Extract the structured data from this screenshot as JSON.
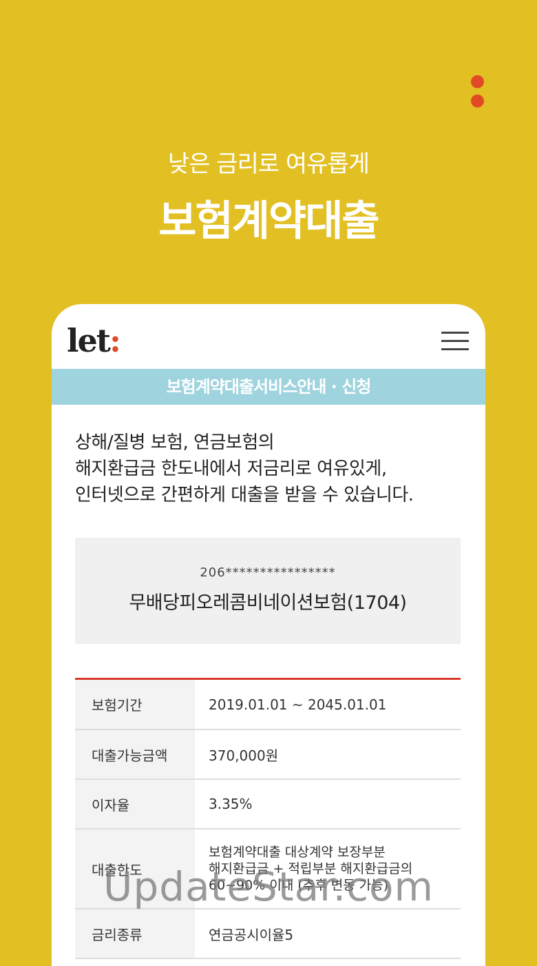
{
  "hero": {
    "subtitle": "낮은 금리로 여유롭게",
    "title": "보험계약대출"
  },
  "app": {
    "logo_text": "let",
    "logo_colon": ":",
    "service_bar": "보험계약대출서비스안내 · 신청"
  },
  "description": {
    "lines": [
      "상해/질병 보험, 연금보험의",
      "해지환급금 한도내에서 저금리로 여유있게,",
      "인터넷으로 간편하게 대출을 받을 수 있습니다."
    ]
  },
  "product": {
    "policy_number": "206****************",
    "name": "무배당피오레콤비네이션보험(1704)"
  },
  "details": [
    {
      "label": "보험기간",
      "value": "2019.01.01 ~ 2045.01.01"
    },
    {
      "label": "대출가능금액",
      "value": "370,000원"
    },
    {
      "label": "이자율",
      "value": "3.35%"
    },
    {
      "label": "대출한도",
      "value_lines": [
        "보험계약대출 대상계약 보장부분",
        "해지환급금 + 적립부분 해지환급금의",
        "60~90% 이내 (추후 변동 가능)"
      ]
    },
    {
      "label": "금리종류",
      "value": "연금공시이율5"
    }
  ],
  "watermark": "UpdateStar.com",
  "colors": {
    "background": "#e2c024",
    "accent_red": "#e24a26",
    "service_bar": "#9fd3de"
  },
  "icons": [
    "more-dots-icon",
    "hamburger-menu-icon"
  ]
}
